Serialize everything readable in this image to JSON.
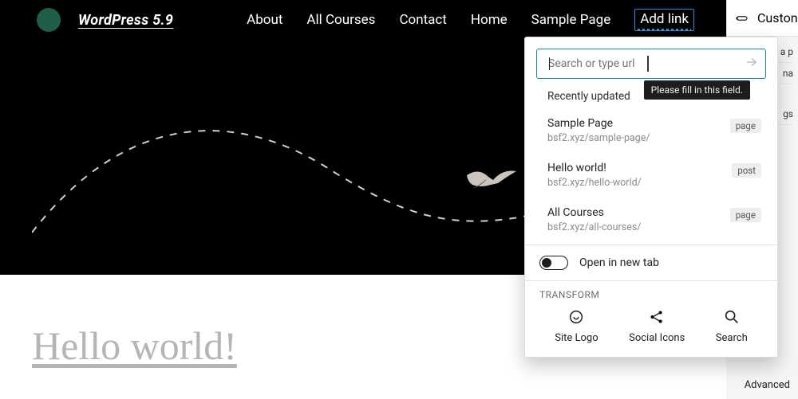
{
  "site": {
    "title": "WordPress 5.9"
  },
  "nav": {
    "items": [
      "About",
      "All Courses",
      "Contact",
      "Home",
      "Sample Page"
    ],
    "add_link_label": "Add link"
  },
  "post": {
    "title": "Hello world!"
  },
  "link_popover": {
    "search_placeholder": "Search or type url",
    "tooltip": "Please fill in this field.",
    "section_label": "Recently updated",
    "results": [
      {
        "title": "Sample Page",
        "url": "bsf2.xyz/sample-page/",
        "type": "page"
      },
      {
        "title": "Hello world!",
        "url": "bsf2.xyz/hello-world/",
        "type": "post"
      },
      {
        "title": "All Courses",
        "url": "bsf2.xyz/all-courses/",
        "type": "page"
      }
    ],
    "open_new_tab_label": "Open in new tab",
    "transform_label": "Transform",
    "transforms": [
      {
        "name": "Site Logo"
      },
      {
        "name": "Social Icons"
      },
      {
        "name": "Search"
      }
    ]
  },
  "settings": {
    "tab": "Custon",
    "frag1": "a p",
    "frag2": "na",
    "frag3": "gs",
    "advanced": "Advanced"
  }
}
